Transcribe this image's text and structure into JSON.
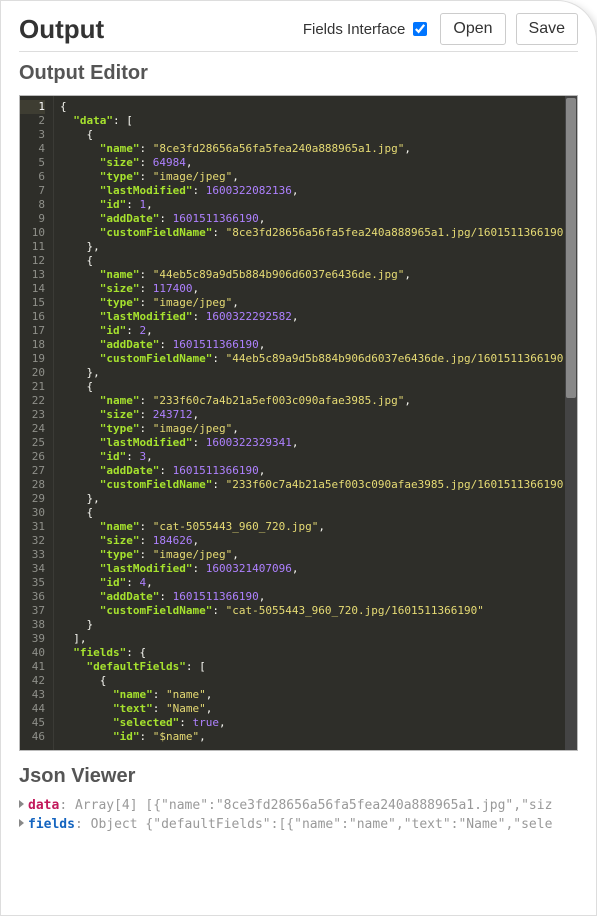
{
  "header": {
    "title": "Output",
    "fields_interface_label": "Fields Interface",
    "fields_interface_checked": true,
    "open_label": "Open",
    "save_label": "Save"
  },
  "editor": {
    "title": "Output Editor",
    "json": {
      "data": [
        {
          "name": "8ce3fd28656a56fa5fea240a888965a1.jpg",
          "size": 64984,
          "type": "image/jpeg",
          "lastModified": 1600322082136,
          "id": 1,
          "addDate": 1601511366190,
          "customFieldName": "8ce3fd28656a56fa5fea240a888965a1.jpg/1601511366190"
        },
        {
          "name": "44eb5c89a9d5b884b906d6037e6436de.jpg",
          "size": 117400,
          "type": "image/jpeg",
          "lastModified": 1600322292582,
          "id": 2,
          "addDate": 1601511366190,
          "customFieldName": "44eb5c89a9d5b884b906d6037e6436de.jpg/1601511366190"
        },
        {
          "name": "233f60c7a4b21a5ef003c090afae3985.jpg",
          "size": 243712,
          "type": "image/jpeg",
          "lastModified": 1600322329341,
          "id": 3,
          "addDate": 1601511366190,
          "customFieldName": "233f60c7a4b21a5ef003c090afae3985.jpg/1601511366190"
        },
        {
          "name": "cat-5055443_960_720.jpg",
          "size": 184626,
          "type": "image/jpeg",
          "lastModified": 1600321407096,
          "id": 4,
          "addDate": 1601511366190,
          "customFieldName": "cat-5055443_960_720.jpg/1601511366190"
        }
      ],
      "fields": {
        "defaultFields": [
          {
            "name": "name",
            "text": "Name",
            "selected": true,
            "id": "$name"
          }
        ]
      }
    }
  },
  "viewer": {
    "title": "Json Viewer",
    "rows": [
      {
        "key": "data",
        "keyClass": "k-data",
        "summary": "Array[4] [{\"name\":\"8ce3fd28656a56fa5fea240a888965a1.jpg\",\"siz"
      },
      {
        "key": "fields",
        "keyClass": "k-fields",
        "summary": "Object {\"defaultFields\":[{\"name\":\"name\",\"text\":\"Name\",\"sele"
      }
    ]
  }
}
